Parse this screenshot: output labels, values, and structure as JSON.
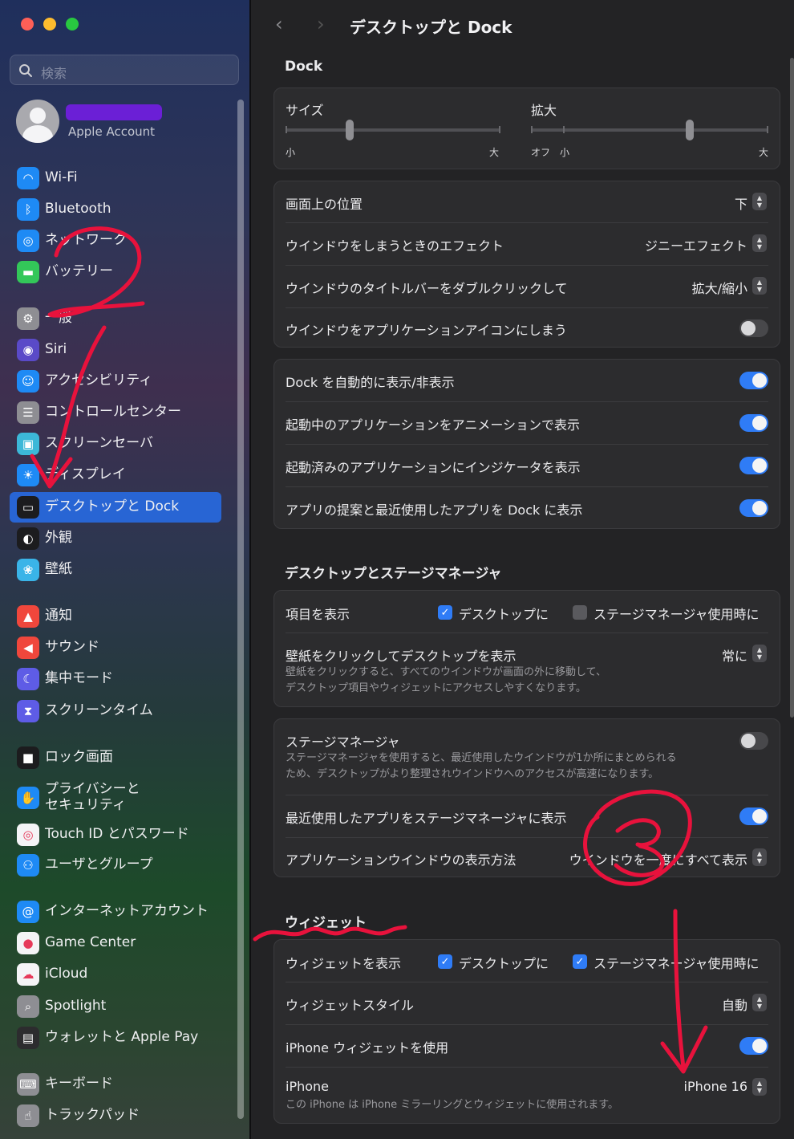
{
  "window": {
    "title": "デスクトップと Dock"
  },
  "search": {
    "placeholder": "検索"
  },
  "account": {
    "label": "Apple Account"
  },
  "sidebar": {
    "items": [
      {
        "label": "Wi-Fi",
        "icon": "wifi-icon",
        "color": "#1e8af5"
      },
      {
        "label": "Bluetooth",
        "icon": "bluetooth-icon",
        "color": "#1e8af5"
      },
      {
        "label": "ネットワーク",
        "icon": "network-globe-icon",
        "color": "#1e8af5"
      },
      {
        "label": "バッテリー",
        "icon": "battery-icon",
        "color": "#33c759"
      },
      {
        "label": "一般",
        "icon": "gear-icon",
        "color": "#8e8e93"
      },
      {
        "label": "Siri",
        "icon": "siri-icon",
        "color": "#5a4ac8"
      },
      {
        "label": "アクセシビリティ",
        "icon": "accessibility-icon",
        "color": "#1e8af5"
      },
      {
        "label": "コントロールセンター",
        "icon": "control-center-icon",
        "color": "#8e8e93"
      },
      {
        "label": "スクリーンセーバ",
        "icon": "screensaver-icon",
        "color": "#3cb8d8"
      },
      {
        "label": "ディスプレイ",
        "icon": "display-brightness-icon",
        "color": "#1e8af5"
      },
      {
        "label": "デスクトップと Dock",
        "icon": "dock-icon",
        "color": "#1c1c1e",
        "selected": true
      },
      {
        "label": "外観",
        "icon": "appearance-icon",
        "color": "#1c1c1e"
      },
      {
        "label": "壁紙",
        "icon": "wallpaper-icon",
        "color": "#3ab4e8"
      },
      {
        "label": "通知",
        "icon": "notification-bell-icon",
        "color": "#f0473c"
      },
      {
        "label": "サウンド",
        "icon": "speaker-icon",
        "color": "#f0473c"
      },
      {
        "label": "集中モード",
        "icon": "moon-icon",
        "color": "#5e5ce6"
      },
      {
        "label": "スクリーンタイム",
        "icon": "hourglass-icon",
        "color": "#5e5ce6"
      },
      {
        "label": "ロック画面",
        "icon": "lock-icon",
        "color": "#1c1c1e"
      },
      {
        "label": "プライバシーと\nセキュリティ",
        "icon": "hand-icon",
        "color": "#1e8af5"
      },
      {
        "label": "Touch ID とパスワード",
        "icon": "fingerprint-icon",
        "color": "#f4f4f6"
      },
      {
        "label": "ユーザとグループ",
        "icon": "users-icon",
        "color": "#1e8af5"
      },
      {
        "label": "インターネットアカウント",
        "icon": "at-icon",
        "color": "#1e8af5"
      },
      {
        "label": "Game Center",
        "icon": "game-center-icon",
        "color": "#f4f4f6"
      },
      {
        "label": "iCloud",
        "icon": "cloud-icon",
        "color": "#f4f4f6"
      },
      {
        "label": "Spotlight",
        "icon": "spotlight-magnifier-icon",
        "color": "#8e8e93"
      },
      {
        "label": "ウォレットと Apple Pay",
        "icon": "wallet-icon",
        "color": "#2c2c2e"
      },
      {
        "label": "キーボード",
        "icon": "keyboard-icon",
        "color": "#8e8e93"
      },
      {
        "label": "トラックパッド",
        "icon": "trackpad-icon",
        "color": "#8e8e93"
      }
    ]
  },
  "dock": {
    "heading": "Dock",
    "size": {
      "label": "サイズ",
      "min": "小",
      "max": "大",
      "value": 0.3
    },
    "magnify": {
      "label": "拡大",
      "off": "オフ",
      "min": "小",
      "max": "大",
      "value": 0.67
    },
    "position": {
      "label": "画面上の位置",
      "value": "下"
    },
    "minimize_effect": {
      "label": "ウインドウをしまうときのエフェクト",
      "value": "ジニーエフェクト"
    },
    "titlebar_dblclick": {
      "label": "ウインドウのタイトルバーをダブルクリックして",
      "value": "拡大/縮小"
    },
    "minimize_into_icon": {
      "label": "ウインドウをアプリケーションアイコンにしまう",
      "on": false
    },
    "autohide": {
      "label": "Dock を自動的に表示/非表示",
      "on": true
    },
    "animate": {
      "label": "起動中のアプリケーションをアニメーションで表示",
      "on": true
    },
    "indicators": {
      "label": "起動済みのアプリケーションにインジケータを表示",
      "on": true
    },
    "suggested": {
      "label": "アプリの提案と最近使用したアプリを Dock に表示",
      "on": true
    }
  },
  "desktop": {
    "heading": "デスクトップとステージマネージャ",
    "show_items": {
      "label": "項目を表示",
      "opt1": "デスクトップに",
      "opt1_on": true,
      "opt2": "ステージマネージャ使用時に",
      "opt2_on": false
    },
    "click_wallpaper": {
      "label": "壁紙をクリックしてデスクトップを表示",
      "value": "常に",
      "sub1": "壁紙をクリックすると、すべてのウインドウが画面の外に移動して、",
      "sub2": "デスクトップ項目やウィジェットにアクセスしやすくなります。"
    },
    "stage_manager": {
      "label": "ステージマネージャ",
      "on": false,
      "sub1": "ステージマネージャを使用すると、最近使用したウインドウが1か所にまとめられる",
      "sub2": "ため、デスクトップがより整理されウインドウへのアクセスが高速になります。"
    },
    "recent_apps": {
      "label": "最近使用したアプリをステージマネージャに表示",
      "on": true
    },
    "app_windows": {
      "label": "アプリケーションウインドウの表示方法",
      "value": "ウインドウを一度にすべて表示"
    }
  },
  "widgets": {
    "heading": "ウィジェット",
    "show": {
      "label": "ウィジェットを表示",
      "opt1": "デスクトップに",
      "opt1_on": true,
      "opt2": "ステージマネージャ使用時に",
      "opt2_on": true
    },
    "style": {
      "label": "ウィジェットスタイル",
      "value": "自動"
    },
    "use_iphone": {
      "label": "iPhone ウィジェットを使用",
      "on": true
    },
    "iphone": {
      "label": "iPhone",
      "value": "iPhone 16",
      "sub": "この iPhone は iPhone ミラーリングとウィジェットに使用されます。"
    }
  },
  "annotations": {
    "mark2": "2",
    "mark3": "3",
    "color": "#e8123c"
  }
}
